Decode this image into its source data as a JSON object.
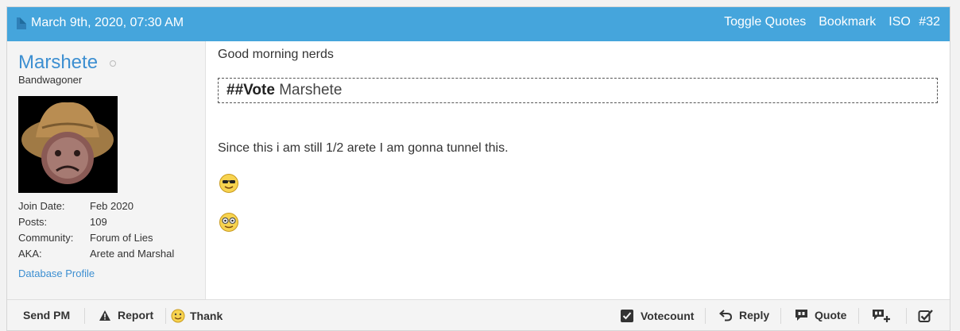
{
  "header": {
    "date": "March 9th, 2020, 07:30 AM",
    "toggle_quotes": "Toggle Quotes",
    "bookmark": "Bookmark",
    "iso": "ISO",
    "post_number": "#32"
  },
  "user": {
    "username": "Marshete",
    "title": "Bandwagoner",
    "stats": [
      {
        "label": "Join Date:",
        "value": "Feb 2020"
      },
      {
        "label": "Posts:",
        "value": "109"
      },
      {
        "label": "Community:",
        "value": "Forum of Lies"
      },
      {
        "label": "AKA:",
        "value": "Arete and Marshal"
      }
    ],
    "database_profile": "Database Profile"
  },
  "post": {
    "greeting": "Good morning nerds",
    "vote_label": "##Vote",
    "vote_target": "Marshete",
    "body": "Since this i am still 1/2 arete I am gonna tunnel this.",
    "smileys": [
      "cool-smiley-icon",
      "nerd-smiley-icon"
    ]
  },
  "footer": {
    "send_pm": "Send PM",
    "report": "Report",
    "thank": "Thank",
    "votecount": "Votecount",
    "reply": "Reply",
    "quote": "Quote"
  },
  "colors": {
    "header_bg": "#45a5dc",
    "link": "#3d8fd1",
    "sidebar_bg": "#f4f4f4"
  }
}
